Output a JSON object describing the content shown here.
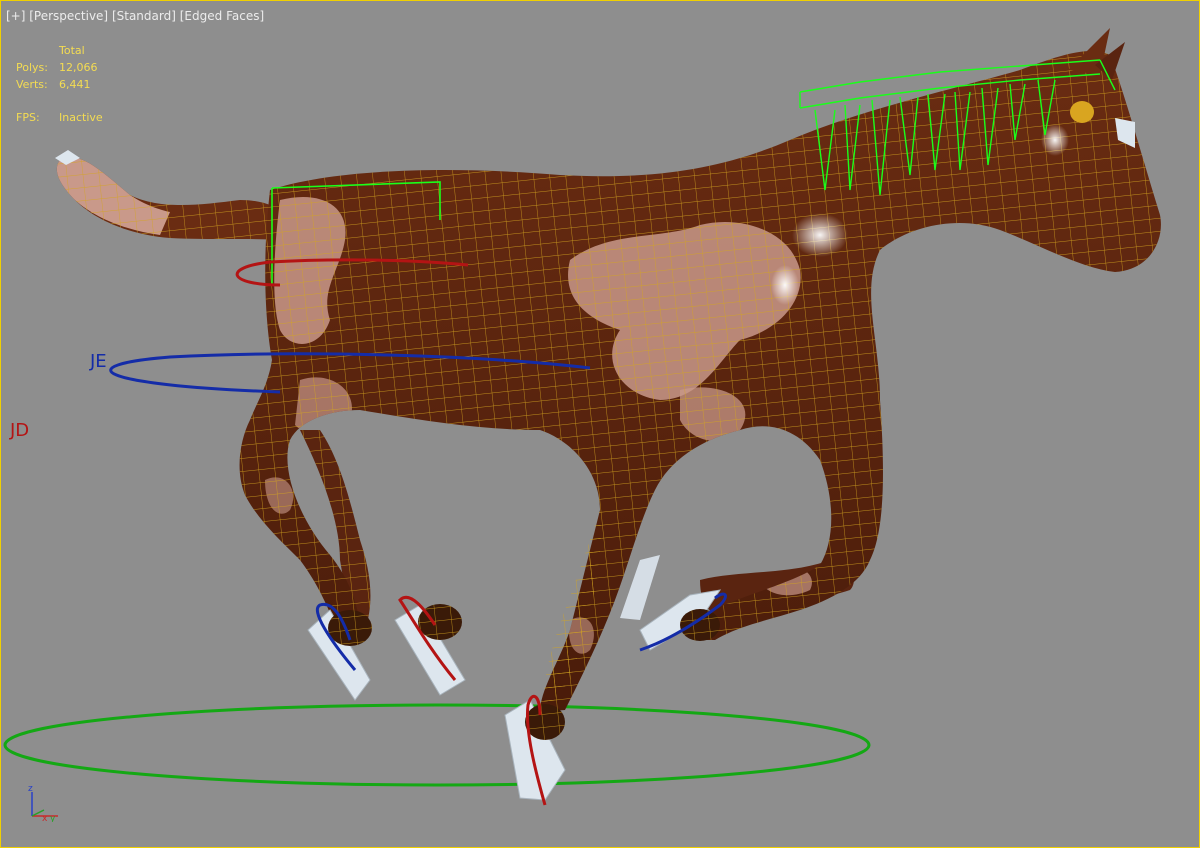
{
  "viewport": {
    "menu_plus": "[+]",
    "view_mode": "[Perspective]",
    "shading_mode": "[Standard]",
    "display_mode": "[Edged Faces]"
  },
  "stats": {
    "header": "Total",
    "polys_label": "Polys:",
    "polys_value": "12,066",
    "verts_label": "Verts:",
    "verts_value": "6,441",
    "fps_label": "FPS:",
    "fps_value": "Inactive"
  },
  "controls": {
    "tail_label": "JE",
    "side_label": "JD"
  },
  "axis": {
    "z": "z",
    "x": "x",
    "y": "y"
  },
  "colors": {
    "background": "#8e8e8e",
    "horse_body": "#5a2410",
    "horse_patch": "#c9998a",
    "wireframe": "#d4a520",
    "spine_control": "#1aff1a",
    "ground_control": "#14a814",
    "blue_control": "#142ca8",
    "red_control": "#b41414",
    "hoof_bone": "#dde6ee",
    "stats_text": "#f4dc52"
  }
}
